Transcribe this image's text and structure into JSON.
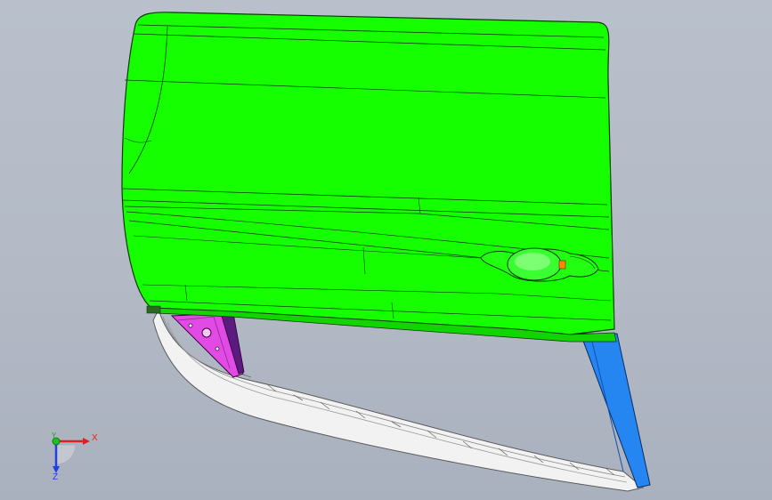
{
  "view": {
    "background_color": "#b5bcc8"
  },
  "model": {
    "door_panel_color": "#15ff00",
    "bracket_color": "#e040e8",
    "pillar_color": "#1e7ef0",
    "seal_color": "#f4f4f4",
    "edge_color": "#0a3a00"
  },
  "triad": {
    "x_label": "X",
    "y_label": "Y",
    "z_label": "Z",
    "x_color": "#e02020",
    "y_color": "#20c020",
    "z_color": "#2040e0"
  }
}
